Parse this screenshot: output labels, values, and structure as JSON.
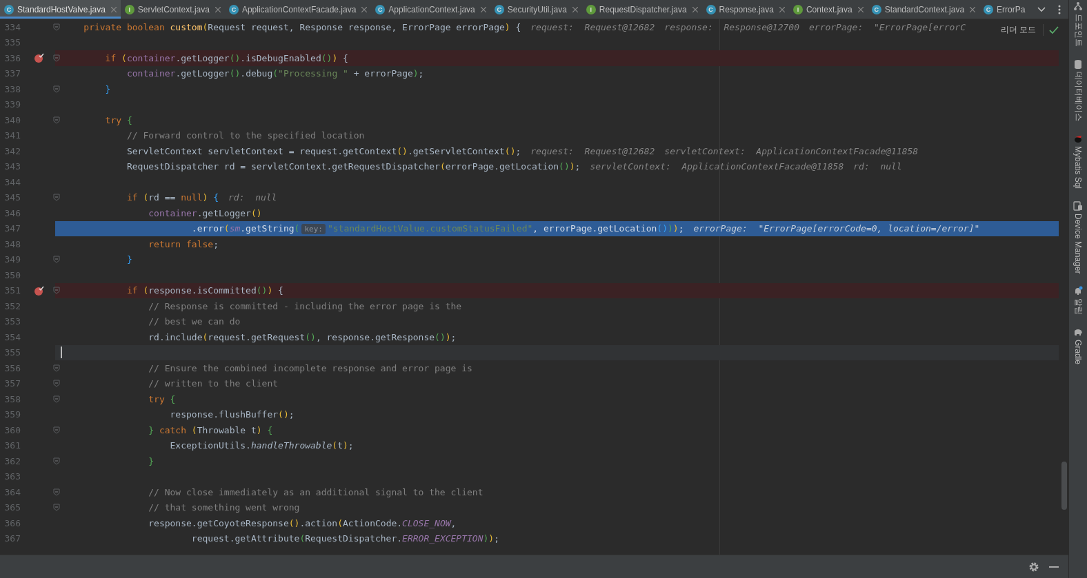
{
  "tabs": [
    {
      "label": "StandardHostValve.java",
      "kind": "class",
      "letter": "C",
      "selected": true,
      "closable": true
    },
    {
      "label": "ServletContext.java",
      "kind": "interface",
      "letter": "I",
      "selected": false,
      "closable": true
    },
    {
      "label": "ApplicationContextFacade.java",
      "kind": "class",
      "letter": "C",
      "selected": false,
      "closable": true
    },
    {
      "label": "ApplicationContext.java",
      "kind": "class",
      "letter": "C",
      "selected": false,
      "closable": true
    },
    {
      "label": "SecurityUtil.java",
      "kind": "class",
      "letter": "C",
      "selected": false,
      "closable": true
    },
    {
      "label": "RequestDispatcher.java",
      "kind": "interface",
      "letter": "I",
      "selected": false,
      "closable": true
    },
    {
      "label": "Response.java",
      "kind": "class",
      "letter": "C",
      "selected": false,
      "closable": true
    },
    {
      "label": "Context.java",
      "kind": "interface",
      "letter": "I",
      "selected": false,
      "closable": true
    },
    {
      "label": "StandardContext.java",
      "kind": "class",
      "letter": "C",
      "selected": false,
      "closable": true
    },
    {
      "label": "ErrorPa",
      "kind": "class",
      "letter": "C",
      "selected": false,
      "closable": false
    }
  ],
  "reader_mode": "리더 모드",
  "lines": [
    {
      "n": "334",
      "breakpoint": false,
      "current": false,
      "caret": false,
      "fold": true,
      "segs": [
        {
          "kind": "keyword",
          "text": "    private boolean "
        },
        {
          "kind": "method",
          "text": "custom"
        },
        {
          "kind": "paren1",
          "text": "("
        },
        {
          "kind": "plain",
          "text": "Request request, Response response, ErrorPage errorPage"
        },
        {
          "kind": "paren1",
          "text": ")"
        },
        {
          "kind": "plain",
          "text": " {"
        }
      ],
      "hints": [
        "request:  Request@12682",
        "response:  Response@12700",
        "errorPage:  \"ErrorPage[errorC"
      ]
    },
    {
      "n": "335",
      "breakpoint": false,
      "current": false,
      "caret": false,
      "fold": false
    },
    {
      "n": "336",
      "breakpoint": true,
      "current": false,
      "caret": false,
      "fold": true,
      "segs": [
        {
          "kind": "keyword",
          "text": "        if "
        },
        {
          "kind": "paren1",
          "text": "("
        },
        {
          "kind": "field",
          "text": "container"
        },
        {
          "kind": "plain",
          "text": ".getLogger"
        },
        {
          "kind": "paren2",
          "text": "()"
        },
        {
          "kind": "plain",
          "text": ".isDebugEnabled"
        },
        {
          "kind": "paren2",
          "text": "()"
        },
        {
          "kind": "paren1",
          "text": ")"
        },
        {
          "kind": "plain",
          "text": " {"
        }
      ]
    },
    {
      "n": "337",
      "breakpoint": false,
      "current": false,
      "caret": false,
      "fold": false,
      "segs": [
        {
          "kind": "field",
          "text": "            container"
        },
        {
          "kind": "plain",
          "text": ".getLogger"
        },
        {
          "kind": "paren2",
          "text": "()"
        },
        {
          "kind": "plain",
          "text": ".debug"
        },
        {
          "kind": "paren2",
          "text": "("
        },
        {
          "kind": "string",
          "text": "\"Processing \""
        },
        {
          "kind": "plain",
          "text": " + errorPage"
        },
        {
          "kind": "paren2",
          "text": ")"
        },
        {
          "kind": "plain",
          "text": ";"
        }
      ]
    },
    {
      "n": "338",
      "breakpoint": false,
      "current": false,
      "caret": false,
      "fold": true,
      "segs": [
        {
          "kind": "paren3",
          "text": "        }"
        }
      ]
    },
    {
      "n": "339",
      "breakpoint": false,
      "current": false,
      "caret": false,
      "fold": false
    },
    {
      "n": "340",
      "breakpoint": false,
      "current": false,
      "caret": false,
      "fold": true,
      "segs": [
        {
          "kind": "keyword",
          "text": "        try "
        },
        {
          "kind": "paren2",
          "text": "{"
        }
      ]
    },
    {
      "n": "341",
      "breakpoint": false,
      "current": false,
      "caret": false,
      "fold": false,
      "segs": [
        {
          "kind": "comment",
          "text": "            // Forward control to the specified location"
        }
      ]
    },
    {
      "n": "342",
      "breakpoint": false,
      "current": false,
      "caret": false,
      "fold": false,
      "segs": [
        {
          "kind": "plain",
          "text": "            ServletContext servletContext = request.getContext"
        },
        {
          "kind": "paren1",
          "text": "()"
        },
        {
          "kind": "plain",
          "text": ".getServletContext"
        },
        {
          "kind": "paren1",
          "text": "()"
        },
        {
          "kind": "plain",
          "text": ";"
        }
      ],
      "hints": [
        "request:  Request@12682",
        "servletContext:  ApplicationContextFacade@11858"
      ]
    },
    {
      "n": "343",
      "breakpoint": false,
      "current": false,
      "caret": false,
      "fold": false,
      "segs": [
        {
          "kind": "plain",
          "text": "            RequestDispatcher rd = servletContext.getRequestDispatcher"
        },
        {
          "kind": "paren1",
          "text": "("
        },
        {
          "kind": "plain",
          "text": "errorPage.getLocation"
        },
        {
          "kind": "paren2",
          "text": "()"
        },
        {
          "kind": "paren1",
          "text": ")"
        },
        {
          "kind": "plain",
          "text": ";"
        }
      ],
      "hints": [
        "servletContext:  ApplicationContextFacade@11858",
        "rd:  null"
      ]
    },
    {
      "n": "344",
      "breakpoint": false,
      "current": false,
      "caret": false,
      "fold": false
    },
    {
      "n": "345",
      "breakpoint": false,
      "current": false,
      "caret": false,
      "fold": true,
      "segs": [
        {
          "kind": "keyword",
          "text": "            if "
        },
        {
          "kind": "paren1",
          "text": "("
        },
        {
          "kind": "plain",
          "text": "rd == "
        },
        {
          "kind": "keyword",
          "text": "null"
        },
        {
          "kind": "paren1",
          "text": ")"
        },
        {
          "kind": "paren3",
          "text": " {"
        }
      ],
      "hints": [
        "rd:  null"
      ]
    },
    {
      "n": "346",
      "breakpoint": false,
      "current": false,
      "caret": false,
      "fold": false,
      "segs": [
        {
          "kind": "field",
          "text": "                container"
        },
        {
          "kind": "plain",
          "text": ".getLogger"
        },
        {
          "kind": "paren1",
          "text": "()"
        }
      ]
    },
    {
      "n": "347",
      "breakpoint": false,
      "current": true,
      "caret": false,
      "fold": false,
      "segs": [
        {
          "kind": "plain",
          "text": "                        .error"
        },
        {
          "kind": "paren1",
          "text": "("
        },
        {
          "kind": "static",
          "text": "sm"
        },
        {
          "kind": "plain",
          "text": ".getString"
        },
        {
          "kind": "paren2",
          "text": "("
        },
        {
          "kind": "param_hint",
          "text": "key:"
        },
        {
          "kind": "string",
          "text": "\"standardHostValue.customStatusFailed\""
        },
        {
          "kind": "plain",
          "text": ", errorPage.getLocation"
        },
        {
          "kind": "paren3",
          "text": "()"
        },
        {
          "kind": "paren2",
          "text": ")"
        },
        {
          "kind": "paren1",
          "text": ")"
        },
        {
          "kind": "plain",
          "text": ";"
        }
      ],
      "hints": [
        "errorPage:  \"ErrorPage[errorCode=0, location=/error]\""
      ]
    },
    {
      "n": "348",
      "breakpoint": false,
      "current": false,
      "caret": false,
      "fold": false,
      "segs": [
        {
          "kind": "keyword",
          "text": "                return false"
        },
        {
          "kind": "plain",
          "text": ";"
        }
      ]
    },
    {
      "n": "349",
      "breakpoint": false,
      "current": false,
      "caret": false,
      "fold": true,
      "segs": [
        {
          "kind": "paren3",
          "text": "            }"
        }
      ]
    },
    {
      "n": "350",
      "breakpoint": false,
      "current": false,
      "caret": false,
      "fold": false
    },
    {
      "n": "351",
      "breakpoint": true,
      "current": false,
      "caret": false,
      "fold": true,
      "segs": [
        {
          "kind": "keyword",
          "text": "            if "
        },
        {
          "kind": "paren1",
          "text": "("
        },
        {
          "kind": "plain",
          "text": "response.isCommitted"
        },
        {
          "kind": "paren2",
          "text": "()"
        },
        {
          "kind": "paren1",
          "text": ")"
        },
        {
          "kind": "plain",
          "text": " {"
        }
      ]
    },
    {
      "n": "352",
      "breakpoint": false,
      "current": false,
      "caret": false,
      "fold": false,
      "segs": [
        {
          "kind": "comment",
          "text": "                // Response is committed - including the error page is the"
        }
      ]
    },
    {
      "n": "353",
      "breakpoint": false,
      "current": false,
      "caret": false,
      "fold": false,
      "segs": [
        {
          "kind": "comment",
          "text": "                // best we can do"
        }
      ]
    },
    {
      "n": "354",
      "breakpoint": false,
      "current": false,
      "caret": false,
      "fold": false,
      "segs": [
        {
          "kind": "plain",
          "text": "                rd.include"
        },
        {
          "kind": "paren1",
          "text": "("
        },
        {
          "kind": "plain",
          "text": "request.getRequest"
        },
        {
          "kind": "paren2",
          "text": "()"
        },
        {
          "kind": "plain",
          "text": ", response.getResponse"
        },
        {
          "kind": "paren2",
          "text": "()"
        },
        {
          "kind": "paren1",
          "text": ")"
        },
        {
          "kind": "plain",
          "text": ";"
        }
      ]
    },
    {
      "n": "355",
      "breakpoint": false,
      "current": false,
      "caret": true,
      "fold": false
    },
    {
      "n": "356",
      "breakpoint": false,
      "current": false,
      "caret": false,
      "fold": true,
      "segs": [
        {
          "kind": "comment",
          "text": "                // Ensure the combined incomplete response and error page is"
        }
      ]
    },
    {
      "n": "357",
      "breakpoint": false,
      "current": false,
      "caret": false,
      "fold": true,
      "segs": [
        {
          "kind": "comment",
          "text": "                // written to the client"
        }
      ]
    },
    {
      "n": "358",
      "breakpoint": false,
      "current": false,
      "caret": false,
      "fold": true,
      "segs": [
        {
          "kind": "keyword",
          "text": "                try "
        },
        {
          "kind": "paren2",
          "text": "{"
        }
      ]
    },
    {
      "n": "359",
      "breakpoint": false,
      "current": false,
      "caret": false,
      "fold": false,
      "segs": [
        {
          "kind": "plain",
          "text": "                    response.flushBuffer"
        },
        {
          "kind": "paren1",
          "text": "()"
        },
        {
          "kind": "plain",
          "text": ";"
        }
      ]
    },
    {
      "n": "360",
      "breakpoint": false,
      "current": false,
      "caret": false,
      "fold": true,
      "segs": [
        {
          "kind": "paren2",
          "text": "                }"
        },
        {
          "kind": "keyword",
          "text": " catch "
        },
        {
          "kind": "paren1",
          "text": "("
        },
        {
          "kind": "plain",
          "text": "Throwable t"
        },
        {
          "kind": "paren1",
          "text": ")"
        },
        {
          "kind": "paren2",
          "text": " {"
        }
      ]
    },
    {
      "n": "361",
      "breakpoint": false,
      "current": false,
      "caret": false,
      "fold": false,
      "segs": [
        {
          "kind": "plain",
          "text": "                    ExceptionUtils."
        },
        {
          "kind": "italic",
          "text": "handleThrowable"
        },
        {
          "kind": "paren1",
          "text": "("
        },
        {
          "kind": "plain",
          "text": "t"
        },
        {
          "kind": "paren1",
          "text": ")"
        },
        {
          "kind": "plain",
          "text": ";"
        }
      ]
    },
    {
      "n": "362",
      "breakpoint": false,
      "current": false,
      "caret": false,
      "fold": true,
      "segs": [
        {
          "kind": "paren2",
          "text": "                }"
        }
      ]
    },
    {
      "n": "363",
      "breakpoint": false,
      "current": false,
      "caret": false,
      "fold": false
    },
    {
      "n": "364",
      "breakpoint": false,
      "current": false,
      "caret": false,
      "fold": true,
      "segs": [
        {
          "kind": "comment",
          "text": "                // Now close immediately as an additional signal to the client"
        }
      ]
    },
    {
      "n": "365",
      "breakpoint": false,
      "current": false,
      "caret": false,
      "fold": true,
      "segs": [
        {
          "kind": "comment",
          "text": "                // that something went wrong"
        }
      ]
    },
    {
      "n": "366",
      "breakpoint": false,
      "current": false,
      "caret": false,
      "fold": false,
      "segs": [
        {
          "kind": "plain",
          "text": "                response.getCoyoteResponse"
        },
        {
          "kind": "paren1",
          "text": "()"
        },
        {
          "kind": "plain",
          "text": ".action"
        },
        {
          "kind": "paren1",
          "text": "("
        },
        {
          "kind": "plain",
          "text": "ActionCode."
        },
        {
          "kind": "static",
          "text": "CLOSE_NOW"
        },
        {
          "kind": "plain",
          "text": ","
        }
      ]
    },
    {
      "n": "367",
      "breakpoint": false,
      "current": false,
      "caret": false,
      "fold": false,
      "segs": [
        {
          "kind": "plain",
          "text": "                        request.getAttribute"
        },
        {
          "kind": "paren2",
          "text": "("
        },
        {
          "kind": "plain",
          "text": "RequestDispatcher."
        },
        {
          "kind": "static",
          "text": "ERROR_EXCEPTION"
        },
        {
          "kind": "paren2",
          "text": ")"
        },
        {
          "kind": "paren1",
          "text": ")"
        },
        {
          "kind": "plain",
          "text": ";"
        }
      ]
    }
  ],
  "tool_windows": [
    {
      "label": "드포인트",
      "kind": "endpoints"
    },
    {
      "label": "데이터베이스",
      "kind": "database"
    },
    {
      "label": "Mybatis Sql",
      "kind": "bird"
    },
    {
      "label": "Device Manager",
      "kind": "device"
    },
    {
      "label": "알림",
      "kind": "bell"
    },
    {
      "label": "Gradle",
      "kind": "elephant"
    }
  ]
}
